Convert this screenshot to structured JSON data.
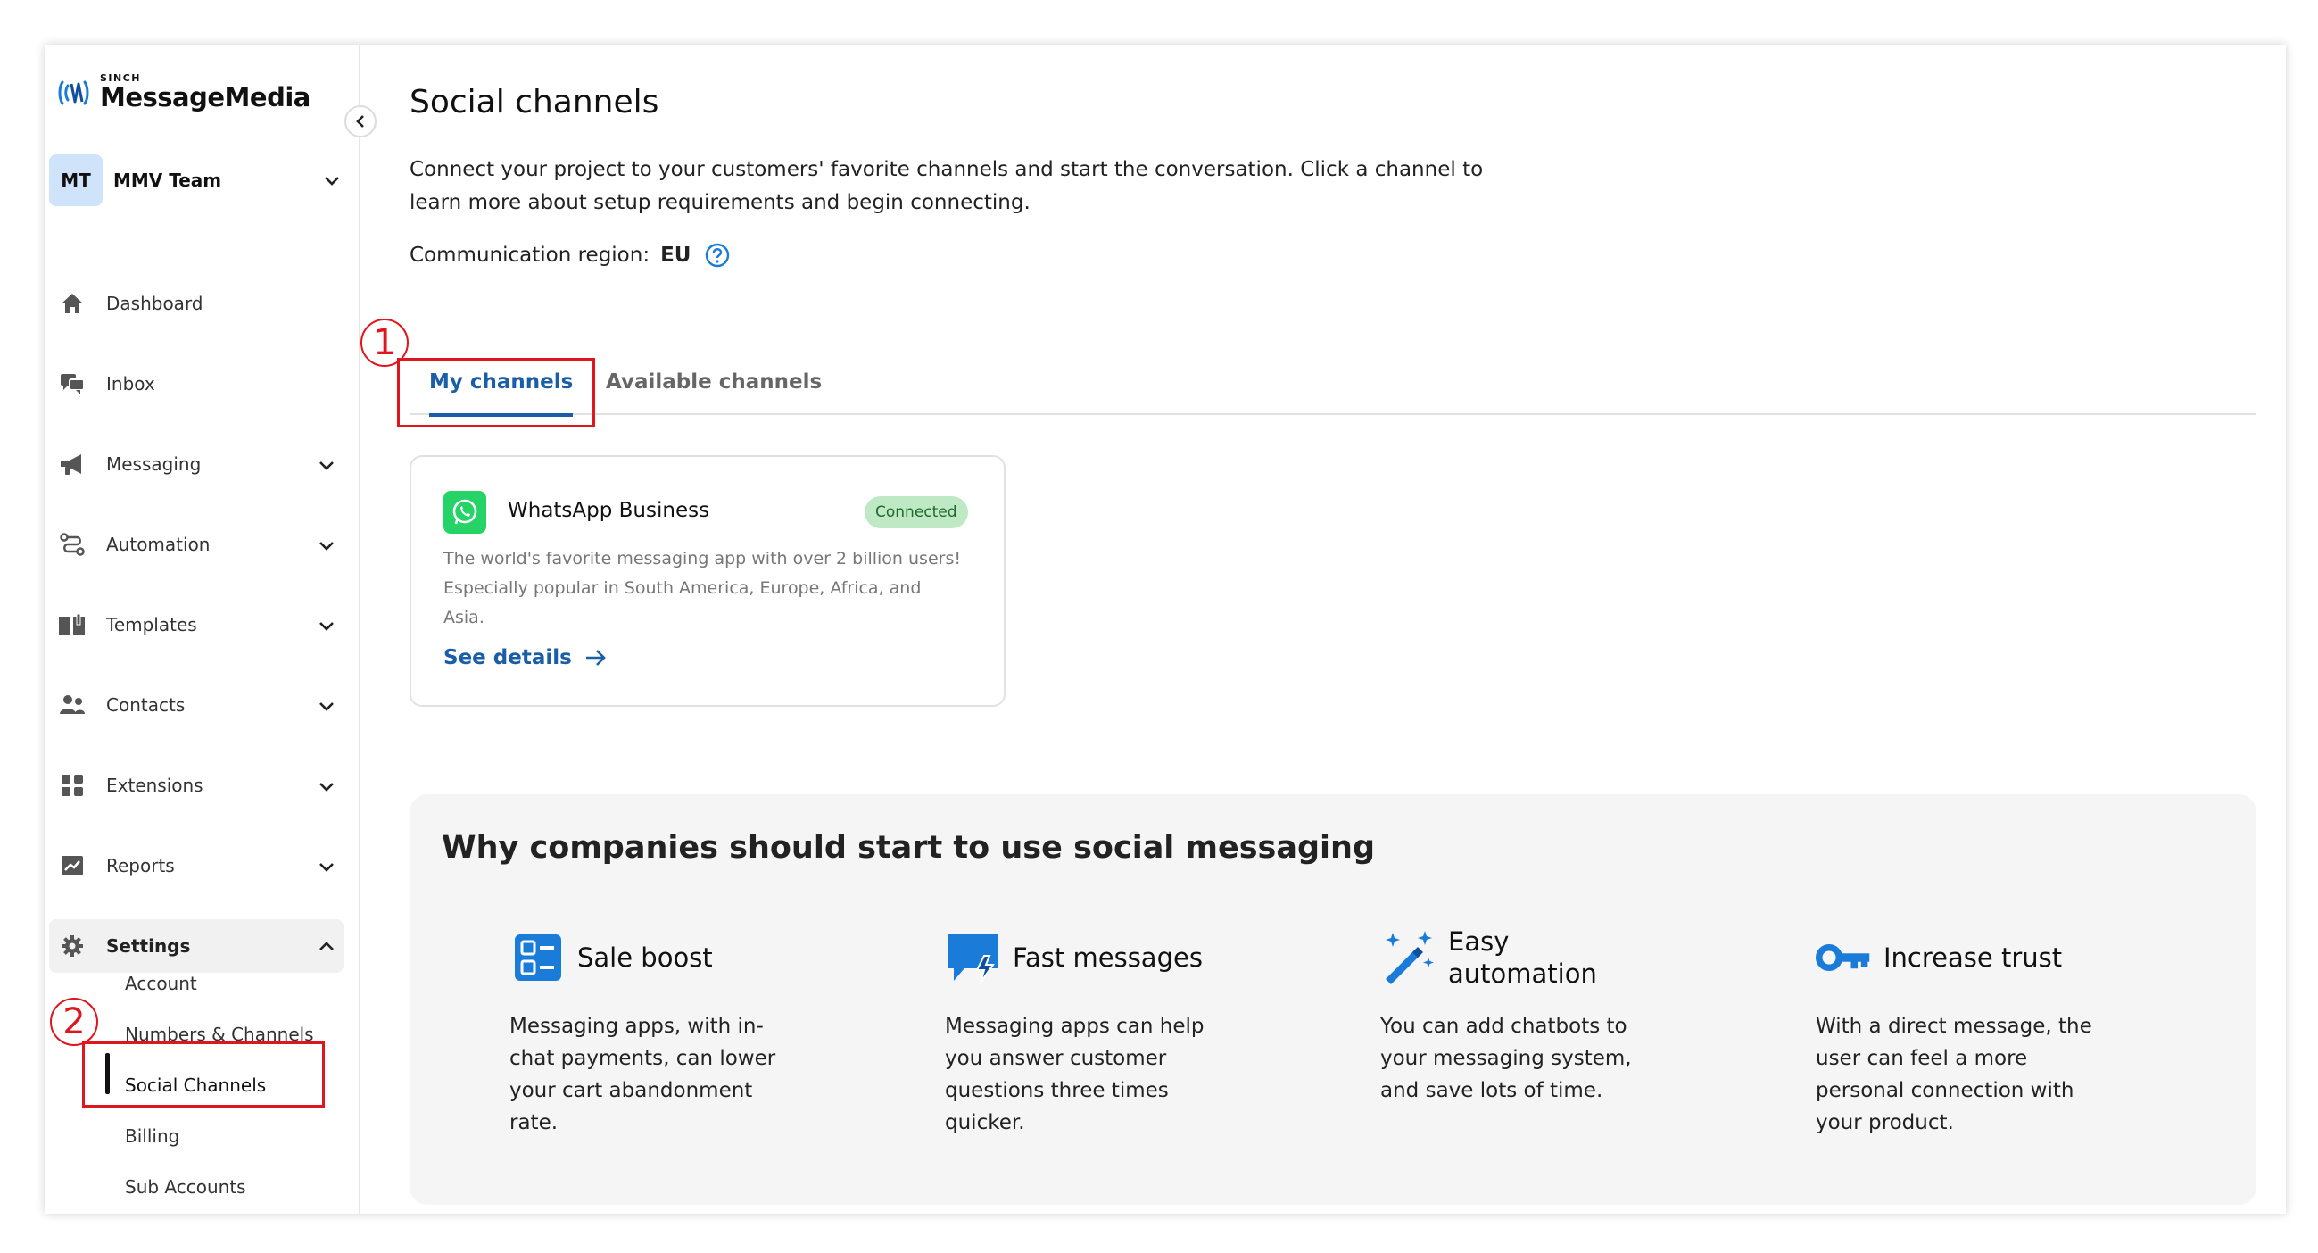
{
  "app": {
    "brand_top": "SINCH",
    "brand": "MessageMedia",
    "accent_color": "#1a5ea8",
    "annotation_color": "#e0161f"
  },
  "sidebar": {
    "team": {
      "initials": "MT",
      "name": "MMV Team"
    },
    "items": [
      {
        "label": "Dashboard",
        "icon": "home-icon"
      },
      {
        "label": "Inbox",
        "icon": "chat-icon"
      },
      {
        "label": "Messaging",
        "icon": "megaphone-icon"
      },
      {
        "label": "Automation",
        "icon": "route-icon"
      },
      {
        "label": "Templates",
        "icon": "book-icon"
      },
      {
        "label": "Contacts",
        "icon": "people-icon"
      },
      {
        "label": "Extensions",
        "icon": "grid-icon"
      },
      {
        "label": "Reports",
        "icon": "chart-icon"
      },
      {
        "label": "Settings",
        "icon": "gear-icon"
      }
    ],
    "settings_sub": [
      "Account",
      "Numbers & Channels",
      "Social Channels",
      "Billing",
      "Sub Accounts"
    ]
  },
  "annotations": [
    "1",
    "2"
  ],
  "main": {
    "title": "Social channels",
    "description_lines": [
      "Connect your project to your customers' favorite channels and start the conversation. Click a channel to",
      "learn more about setup requirements and begin connecting."
    ],
    "region_label": "Communication region:",
    "region_value": "EU",
    "tabs": [
      "My channels",
      "Available channels"
    ],
    "channel_card": {
      "title": "WhatsApp Business",
      "status": "Connected",
      "status_color": "#bfe8c5",
      "description_lines": [
        "The world's favorite messaging app with over 2 billion users!",
        "Especially popular in South America, Europe, Africa, and",
        "Asia."
      ],
      "link": "See details"
    },
    "why": {
      "title": "Why companies should start to use social messaging",
      "features": [
        {
          "icon": "checklist-icon",
          "title_lines": [
            "Sale boost"
          ],
          "desc_lines": [
            "Messaging apps, with in-",
            "chat payments, can lower",
            "your cart abandonment",
            "rate."
          ]
        },
        {
          "icon": "fast-message-icon",
          "title_lines": [
            "Fast messages"
          ],
          "desc_lines": [
            "Messaging apps can help",
            "you answer customer",
            "questions three times",
            "quicker."
          ]
        },
        {
          "icon": "magic-wand-icon",
          "title_lines": [
            "Easy",
            "automation"
          ],
          "desc_lines": [
            "You can add chatbots to",
            "your messaging system,",
            "and save lots of time."
          ]
        },
        {
          "icon": "key-icon",
          "title_lines": [
            "Increase trust"
          ],
          "desc_lines": [
            "With a direct message, the",
            "user can feel a more",
            "personal connection with",
            "your product."
          ]
        }
      ]
    }
  }
}
